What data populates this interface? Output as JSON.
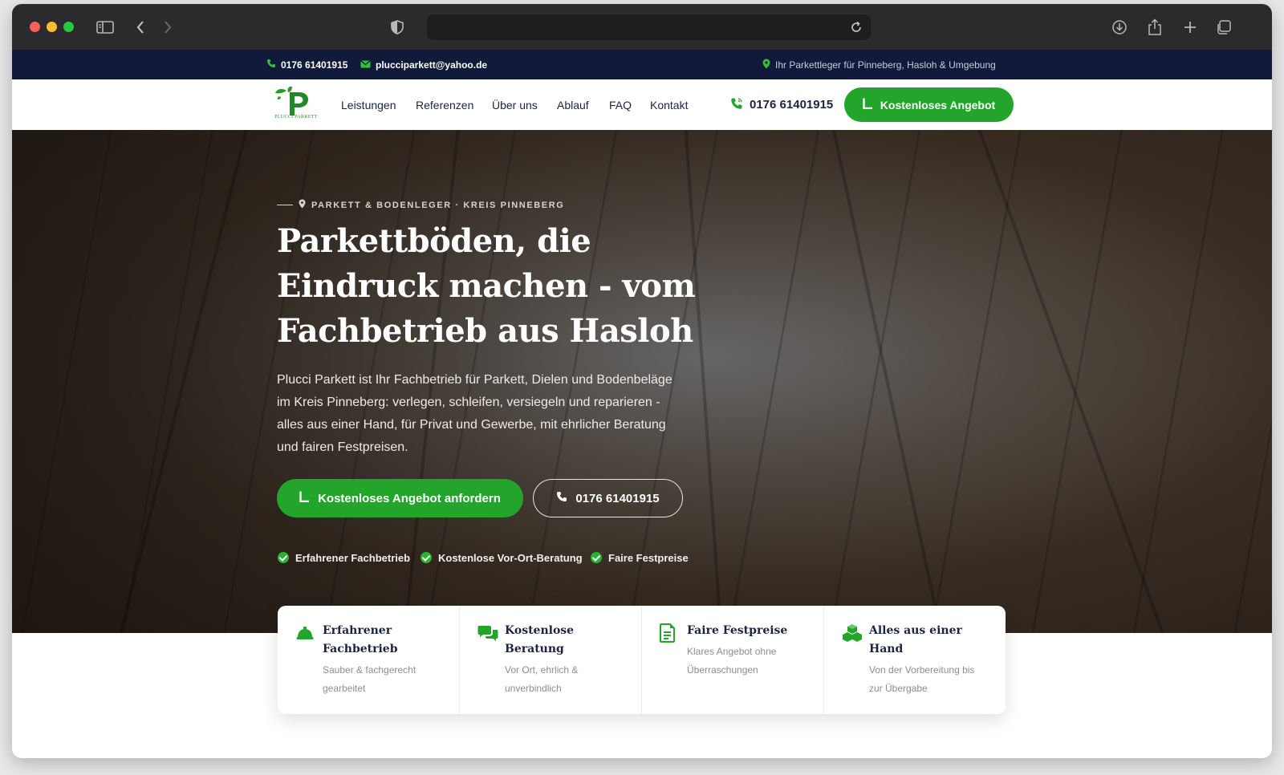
{
  "browser": {
    "url": "",
    "icons": [
      "sidebar-icon",
      "back-icon",
      "forward-icon",
      "shield-icon",
      "reload-icon",
      "download-icon",
      "share-icon",
      "new-tab-icon",
      "tabs-overview-icon"
    ]
  },
  "topbar": {
    "phone": "0176 61401915",
    "email": "plucciparkett@yahoo.de",
    "tagline": "Ihr Parkettleger für Pinneberg, Hasloh & Umgebung"
  },
  "nav": {
    "logo_text": "PLUCCI PARKETT",
    "links": [
      "Leistungen",
      "Referenzen",
      "Über uns",
      "Ablauf",
      "FAQ",
      "Kontakt"
    ],
    "phone": "0176 61401915",
    "cta": "Kostenloses Angebot"
  },
  "hero": {
    "eyebrow": "PARKETT & BODENLEGER · KREIS PINNEBERG",
    "title": "Parkettböden, die Eindruck machen - vom Fachbetrieb aus Hasloh",
    "description": "Plucci Parkett ist Ihr Fachbetrieb für Parkett, Dielen und Bodenbeläge im Kreis Pinneberg: verlegen, schleifen, versiegeln und reparieren - alles aus einer Hand, für Privat und Gewerbe, mit ehrlicher Beratung und fairen Festpreisen.",
    "primary_button": "Kostenloses Angebot anfordern",
    "phone_button": "0176 61401915",
    "trust": [
      "Erfahrener Fachbetrieb",
      "Kostenlose Vor-Ort-Beratung",
      "Faire Festpreise"
    ]
  },
  "features": [
    {
      "icon": "helmet-icon",
      "title": "Erfahrener Fachbetrieb",
      "desc": "Sauber & fachgerecht gearbeitet"
    },
    {
      "icon": "chat-icon",
      "title": "Kostenlose Beratung",
      "desc": "Vor Ort, ehrlich & unverbindlich"
    },
    {
      "icon": "document-icon",
      "title": "Faire Festpreise",
      "desc": "Klares Angebot ohne Überraschungen"
    },
    {
      "icon": "boxes-icon",
      "title": "Alles aus einer Hand",
      "desc": "Von der Vorbereitung bis zur Übergabe"
    }
  ],
  "colors": {
    "brand_green": "#22a52a",
    "navy": "#111a3a",
    "text_dark": "#1b2340"
  }
}
